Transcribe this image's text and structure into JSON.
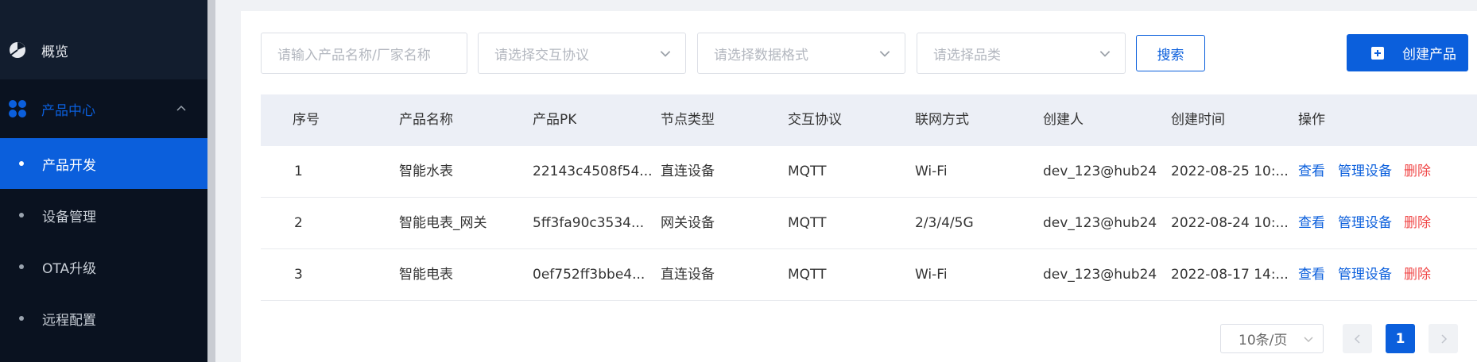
{
  "sidebar": {
    "overview": "概览",
    "product_center": "产品中心",
    "sub_items": [
      "产品开发",
      "设备管理",
      "OTA升级",
      "远程配置"
    ]
  },
  "filters": {
    "name_placeholder": "请输入产品名称/厂家名称",
    "protocol_placeholder": "请选择交互协议",
    "format_placeholder": "请选择数据格式",
    "category_placeholder": "请选择品类",
    "search_label": "搜索",
    "create_label": "创建产品"
  },
  "table": {
    "headers": [
      "序号",
      "产品名称",
      "产品PK",
      "节点类型",
      "交互协议",
      "联网方式",
      "创建人",
      "创建时间",
      "操作"
    ],
    "rows": [
      [
        "1",
        "智能水表",
        "22143c4508f54...",
        "直连设备",
        "MQTT",
        "Wi-Fi",
        "dev_123@hub24",
        "2022-08-25 10:..."
      ],
      [
        "2",
        "智能电表_网关",
        "5ff3fa90c3534...",
        "网关设备",
        "MQTT",
        "2/3/4/5G",
        "dev_123@hub24",
        "2022-08-24 10:..."
      ],
      [
        "3",
        "智能电表",
        "0ef752ff3bbe4...",
        "直连设备",
        "MQTT",
        "Wi-Fi",
        "dev_123@hub24",
        "2022-08-17 14:..."
      ]
    ],
    "actions": {
      "view": "查看",
      "manage": "管理设备",
      "delete": "删除"
    }
  },
  "pagination": {
    "page_size": "10条/页",
    "current_page": "1"
  },
  "colors": {
    "accent": "#0b5fdc",
    "danger": "#f04848",
    "sidebar_bg": "#0f1a2a",
    "header_bg": "#eceff6"
  }
}
